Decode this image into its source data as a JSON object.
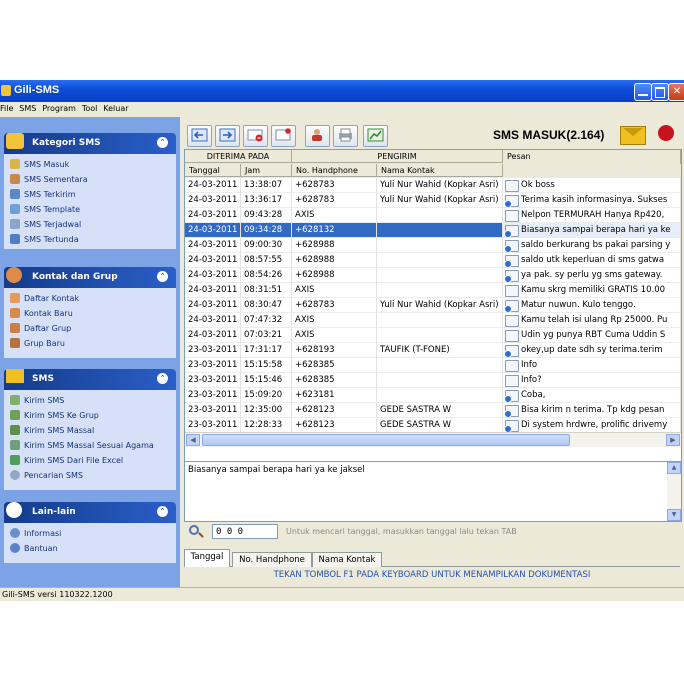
{
  "window": {
    "title": "Gili-SMS"
  },
  "menu": [
    "File",
    "SMS",
    "Program",
    "Tool",
    "Keluar"
  ],
  "sidebar": {
    "panels": [
      {
        "title": "Kategori SMS",
        "toggle": "⌃",
        "items": [
          "SMS Masuk",
          "SMS Sementara",
          "SMS Terkirim",
          "SMS Template",
          "SMS Terjadwal",
          "SMS Tertunda"
        ]
      },
      {
        "title": "Kontak dan Grup",
        "toggle": "⌃",
        "items": [
          "Daftar Kontak",
          "Kontak Baru",
          "Daftar Grup",
          "Grup Baru"
        ]
      },
      {
        "title": "SMS",
        "toggle": "⌃",
        "items": [
          "Kirim SMS",
          "Kirim SMS Ke Grup",
          "Kirim SMS Massal",
          "Kirim SMS Massal Sesuai Agama",
          "Kirim SMS Dari File Excel",
          "Pencarian SMS"
        ]
      },
      {
        "title": "Lain-lain",
        "toggle": "⌃",
        "items": [
          "Informasi",
          "Bantuan"
        ]
      }
    ]
  },
  "status": {
    "version": "Gili-SMS versi 110322.1200"
  },
  "header": {
    "title": "SMS MASUK(2.164)"
  },
  "toolbar": {
    "icons": [
      "import-icon",
      "export-icon",
      "delete-icon",
      "mark-icon",
      "contact-icon",
      "print-icon",
      "chart-icon"
    ]
  },
  "grid": {
    "group_headers": [
      "DITERIMA PADA",
      "PENGIRIM",
      "Pesan"
    ],
    "columns": [
      "Tanggal",
      "Jam",
      "No. Handphone",
      "Nama Kontak"
    ],
    "rows": [
      {
        "date": "24-03-2011",
        "time": "13:38:07",
        "phone": "+628783",
        "name": "Yuli Nur Wahid (Kopkar Asri)",
        "message": "Ok boss",
        "icon": "read"
      },
      {
        "date": "24-03-2011",
        "time": "13:36:17",
        "phone": "+628783",
        "name": "Yuli Nur Wahid (Kopkar Asri)",
        "message": "Terima kasih informasinya. Sukses",
        "icon": "reply"
      },
      {
        "date": "24-03-2011",
        "time": "09:43:28",
        "phone": "AXIS",
        "name": "",
        "message": "Nelpon TERMURAH Hanya Rp420,",
        "icon": "read"
      },
      {
        "date": "24-03-2011",
        "time": "09:34:28",
        "phone": "+628132",
        "name": "",
        "message": "Biasanya sampai berapa hari ya ke",
        "icon": "reply",
        "selected": true
      },
      {
        "date": "24-03-2011",
        "time": "09:00:30",
        "phone": "+628988",
        "name": "",
        "message": "saldo berkurang bs pakai parsing y",
        "icon": "reply"
      },
      {
        "date": "24-03-2011",
        "time": "08:57:55",
        "phone": "+628988",
        "name": "",
        "message": "saldo utk keperluan di sms gatwa",
        "icon": "reply"
      },
      {
        "date": "24-03-2011",
        "time": "08:54:26",
        "phone": "+628988",
        "name": "",
        "message": "ya pak. sy perlu yg sms gateway.",
        "icon": "reply"
      },
      {
        "date": "24-03-2011",
        "time": "08:31:51",
        "phone": "AXIS",
        "name": "",
        "message": "Kamu skrg memiliki GRATIS 10.00",
        "icon": "read"
      },
      {
        "date": "24-03-2011",
        "time": "08:30:47",
        "phone": "+628783",
        "name": "Yuli Nur Wahid (Kopkar Asri)",
        "message": "Matur nuwun. Kulo tenggo.",
        "icon": "reply"
      },
      {
        "date": "24-03-2011",
        "time": "07:47:32",
        "phone": "AXIS",
        "name": "",
        "message": "Kamu telah isi ulang Rp 25000. Pu",
        "icon": "read"
      },
      {
        "date": "24-03-2011",
        "time": "07:03:21",
        "phone": "AXIS",
        "name": "",
        "message": "Udin yg punya RBT Cuma Uddin S",
        "icon": "read"
      },
      {
        "date": "23-03-2011",
        "time": "17:31:17",
        "phone": "+628193",
        "name": "TAUFIK (T-FONE)",
        "message": "okey,up date sdh sy terima.terim",
        "icon": "reply"
      },
      {
        "date": "23-03-2011",
        "time": "15:15:58",
        "phone": "+628385",
        "name": "",
        "message": "Info",
        "icon": "read"
      },
      {
        "date": "23-03-2011",
        "time": "15:15:46",
        "phone": "+628385",
        "name": "",
        "message": "Info?",
        "icon": "read"
      },
      {
        "date": "23-03-2011",
        "time": "15:09:20",
        "phone": "+623181",
        "name": "",
        "message": "Coba,",
        "icon": "reply"
      },
      {
        "date": "23-03-2011",
        "time": "12:35:00",
        "phone": "+628123",
        "name": "GEDE SASTRA W",
        "message": "Bisa kirim n terima. Tp kdg pesan",
        "icon": "reply"
      },
      {
        "date": "23-03-2011",
        "time": "12:28:33",
        "phone": "+628123",
        "name": "GEDE SASTRA W",
        "message": "Di system hrdwre, prolific drivemy",
        "icon": "reply"
      }
    ]
  },
  "message_view": {
    "text": "Biasanya sampai berapa hari ya ke jaksel"
  },
  "search": {
    "value": "0 0 0",
    "hint": "Untuk mencari tanggal, masukkan tanggal lalu tekan TAB"
  },
  "tabs": [
    {
      "label": "Tanggal",
      "active": true
    },
    {
      "label": "No. Handphone",
      "active": false
    },
    {
      "label": "Nama Kontak",
      "active": false
    }
  ],
  "footer": {
    "note": "TEKAN TOMBOL F1 PADA KEYBOARD UNTUK MENAMPILKAN DOKUMENTASI"
  },
  "colors": {
    "accent": "#316ac5",
    "sidebar": "#7ba3e5",
    "panel_header": "#153b8a",
    "link": "#2251b2"
  }
}
